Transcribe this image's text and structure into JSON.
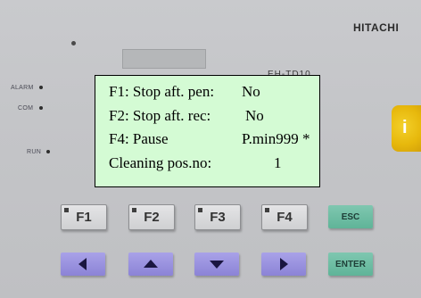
{
  "panel": {
    "brand": "HITACHI",
    "model": "EH-TD10",
    "leds": [
      "ALARM",
      "COM",
      "RUN"
    ],
    "info_key": "i",
    "function_keys": [
      "F1",
      "F2",
      "F3",
      "F4"
    ],
    "esc_key": "ESC",
    "enter_key": "ENTER",
    "arrow_keys": [
      "left-arrow-icon",
      "up-arrow-icon",
      "down-arrow-icon",
      "right-arrow-icon"
    ],
    "colors": {
      "housing": "#c6c7ca",
      "function_key": "#dcdcde",
      "nav_key": "#968fdd",
      "green_key": "#6dbda3",
      "info_key": "#e9bb10",
      "overlay_bg": "#d4fbd4"
    }
  },
  "display": {
    "rows": [
      {
        "label": "F1: Stop aft. pen:",
        "value": "No"
      },
      {
        "label": "F2: Stop aft. rec:",
        "value": "No"
      },
      {
        "label": "F4: Pause",
        "value": "P.min999 *"
      },
      {
        "label": "Cleaning pos.no:",
        "value": "1"
      }
    ]
  }
}
